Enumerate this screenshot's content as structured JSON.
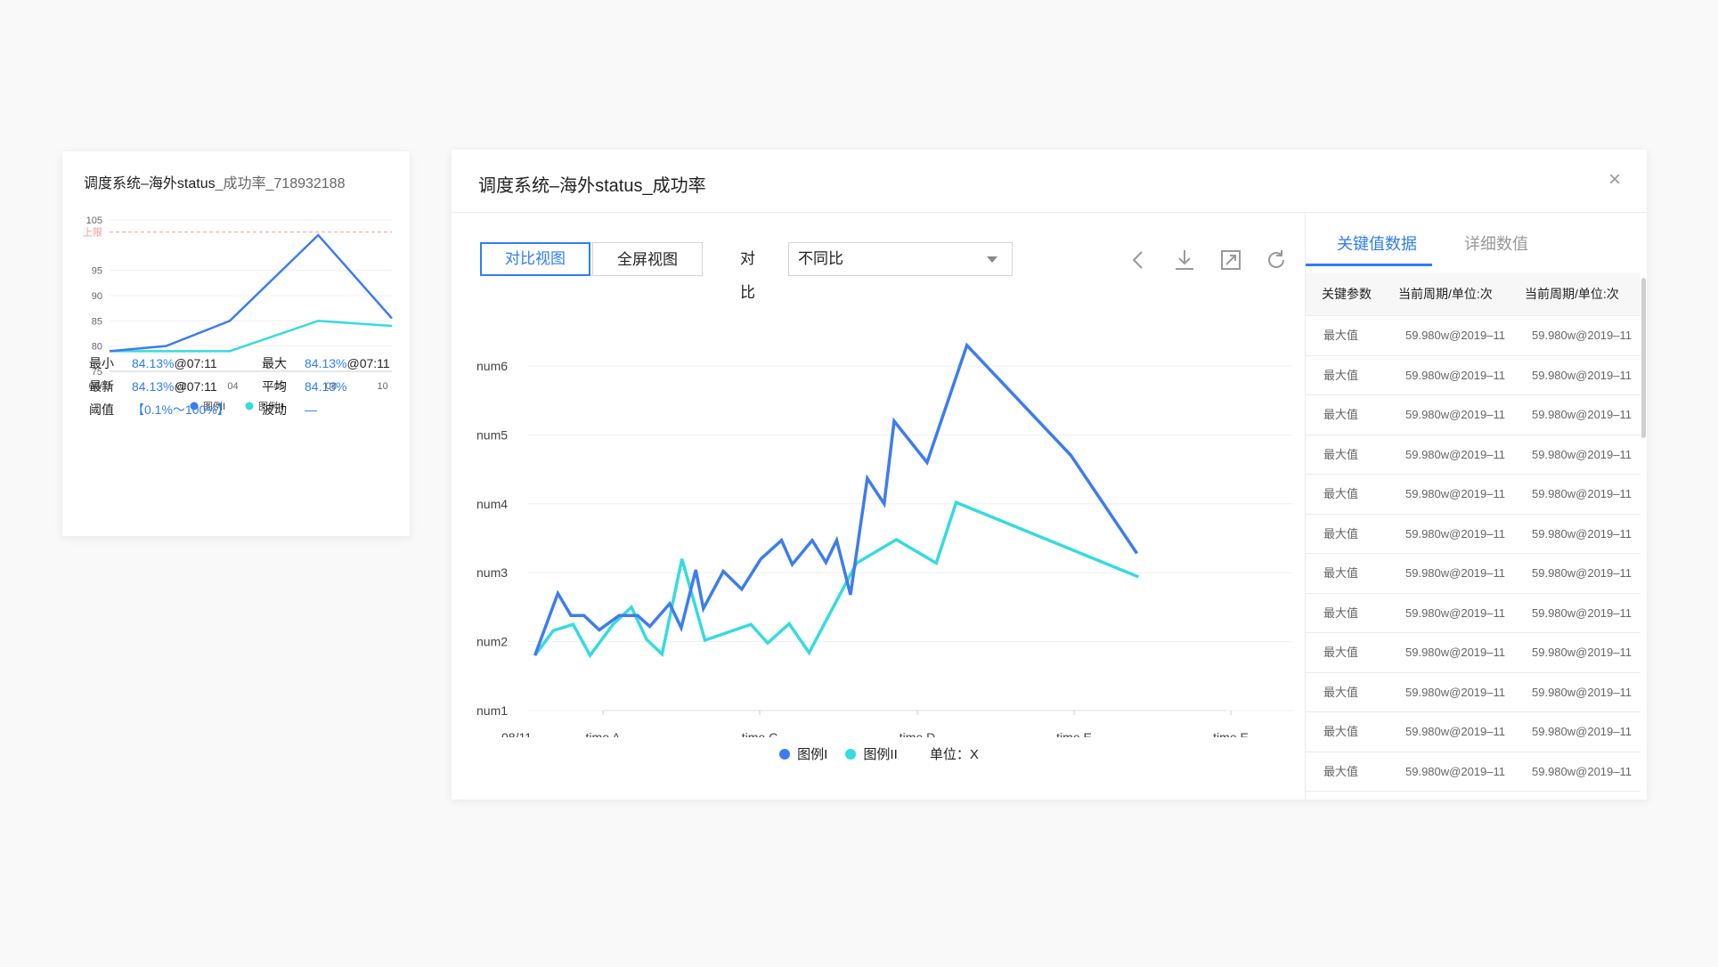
{
  "small_card": {
    "title_main": "调度系统–海外status",
    "title_id": "_成功率_718932188",
    "stats": [
      {
        "label": "最小",
        "value": "84.13%",
        "tail": "@07:11"
      },
      {
        "label": "最大",
        "value": "84.13%",
        "tail": "@07:11"
      },
      {
        "label": "最新",
        "value": "84.13%",
        "tail": "@07:11"
      },
      {
        "label": "平均",
        "value": "84.13%",
        "tail": ""
      },
      {
        "label": "阈值",
        "value": "【0.1%～100%】",
        "tail": ""
      },
      {
        "label": "波动",
        "value": "—",
        "tail": ""
      }
    ],
    "legend": [
      "图例I",
      "图例II"
    ]
  },
  "modal": {
    "title": "调度系统–海外status_成功率",
    "close_icon": "×",
    "toolbar": {
      "view_compare": "对比视图",
      "view_full": "全屏视图",
      "compare_label": "对比",
      "compare_value": "不同比"
    },
    "icons": [
      "chevron-left-icon",
      "download-icon",
      "expand-icon",
      "refresh-icon"
    ],
    "legend": [
      "图例I",
      "图例II"
    ],
    "unit_label": "单位：X",
    "side": {
      "tab_active": "关键值数据",
      "tab_inactive": "详细数值",
      "table_headers": [
        "关键参数",
        "当前周期/单位:次",
        "当前周期/单位:次"
      ],
      "table_rows": [
        [
          "最大值",
          "59.980w@2019–11",
          "59.980w@2019–11"
        ],
        [
          "最大值",
          "59.980w@2019–11",
          "59.980w@2019–11"
        ],
        [
          "最大值",
          "59.980w@2019–11",
          "59.980w@2019–11"
        ],
        [
          "最大值",
          "59.980w@2019–11",
          "59.980w@2019–11"
        ],
        [
          "最大值",
          "59.980w@2019–11",
          "59.980w@2019–11"
        ],
        [
          "最大值",
          "59.980w@2019–11",
          "59.980w@2019–11"
        ],
        [
          "最大值",
          "59.980w@2019–11",
          "59.980w@2019–11"
        ],
        [
          "最大值",
          "59.980w@2019–11",
          "59.980w@2019–11"
        ],
        [
          "最大值",
          "59.980w@2019–11",
          "59.980w@2019–11"
        ],
        [
          "最大值",
          "59.980w@2019–11",
          "59.980w@2019–11"
        ],
        [
          "最大值",
          "59.980w@2019–11",
          "59.980w@2019–11"
        ],
        [
          "最大值",
          "59.980w@2019–11",
          "59.980w@2019–11"
        ]
      ]
    }
  },
  "colors": {
    "series1": "#3d7cf0",
    "series2": "#35dbe0",
    "accent": "#2f7df6",
    "threshold": "#f2999a"
  },
  "chart_data": [
    {
      "type": "line",
      "title": "调度系统–海外status_成功率_718932188",
      "x_ticks": [
        "08/11",
        "02",
        "04",
        "06",
        "08",
        "10"
      ],
      "x": [
        0,
        2.3,
        4.9,
        8.5,
        11.5
      ],
      "ylim": [
        75,
        105
      ],
      "y_ticks": [
        75,
        80,
        85,
        90,
        95,
        100,
        105
      ],
      "threshold": {
        "label": "上限",
        "value": 102.6
      },
      "series": [
        {
          "name": "图例I",
          "values": [
            79,
            80,
            85,
            102,
            85.5
          ]
        },
        {
          "name": "图例II",
          "values": [
            79,
            79,
            79,
            85,
            84
          ]
        }
      ],
      "legend": "bottom"
    },
    {
      "type": "line",
      "y_ticks": [
        "num1",
        "num2",
        "num3",
        "num4",
        "num5",
        "num6"
      ],
      "ylim": [
        1,
        6
      ],
      "x_ticks": [
        "08/11",
        "time A",
        "time C",
        "time D",
        "time E",
        "time E"
      ],
      "xlim": [
        0,
        10
      ],
      "grid": true,
      "legend": "bottom",
      "series": [
        {
          "name": "图例I",
          "points": [
            [
              0.1,
              1.8
            ],
            [
              0.4,
              2.7
            ],
            [
              0.57,
              2.38
            ],
            [
              0.74,
              2.38
            ],
            [
              0.94,
              2.17
            ],
            [
              1.2,
              2.38
            ],
            [
              1.44,
              2.38
            ],
            [
              1.6,
              2.22
            ],
            [
              1.86,
              2.55
            ],
            [
              2.01,
              2.2
            ],
            [
              2.2,
              3.04
            ],
            [
              2.3,
              2.48
            ],
            [
              2.56,
              3.02
            ],
            [
              2.8,
              2.76
            ],
            [
              3.05,
              3.2
            ],
            [
              3.32,
              3.47
            ],
            [
              3.46,
              3.12
            ],
            [
              3.72,
              3.47
            ],
            [
              3.9,
              3.15
            ],
            [
              4.04,
              3.47
            ],
            [
              4.22,
              2.68
            ],
            [
              4.44,
              4.37
            ],
            [
              4.66,
              4.0
            ],
            [
              4.79,
              5.2
            ],
            [
              5.22,
              4.6
            ],
            [
              5.74,
              6.3
            ],
            [
              7.1,
              4.7
            ],
            [
              7.96,
              3.28
            ]
          ]
        },
        {
          "name": "图例II",
          "points": [
            [
              0.1,
              1.8
            ],
            [
              0.34,
              2.16
            ],
            [
              0.6,
              2.25
            ],
            [
              0.82,
              1.8
            ],
            [
              1.12,
              2.25
            ],
            [
              1.36,
              2.5
            ],
            [
              1.56,
              2.03
            ],
            [
              1.76,
              1.82
            ],
            [
              2.02,
              3.2
            ],
            [
              2.32,
              2.02
            ],
            [
              2.92,
              2.25
            ],
            [
              3.14,
              1.98
            ],
            [
              3.42,
              2.26
            ],
            [
              3.68,
              1.84
            ],
            [
              4.3,
              3.14
            ],
            [
              4.82,
              3.48
            ],
            [
              5.34,
              3.14
            ],
            [
              5.6,
              4.02
            ],
            [
              7.98,
              2.94
            ]
          ]
        }
      ],
      "unit": "单位：X"
    }
  ]
}
